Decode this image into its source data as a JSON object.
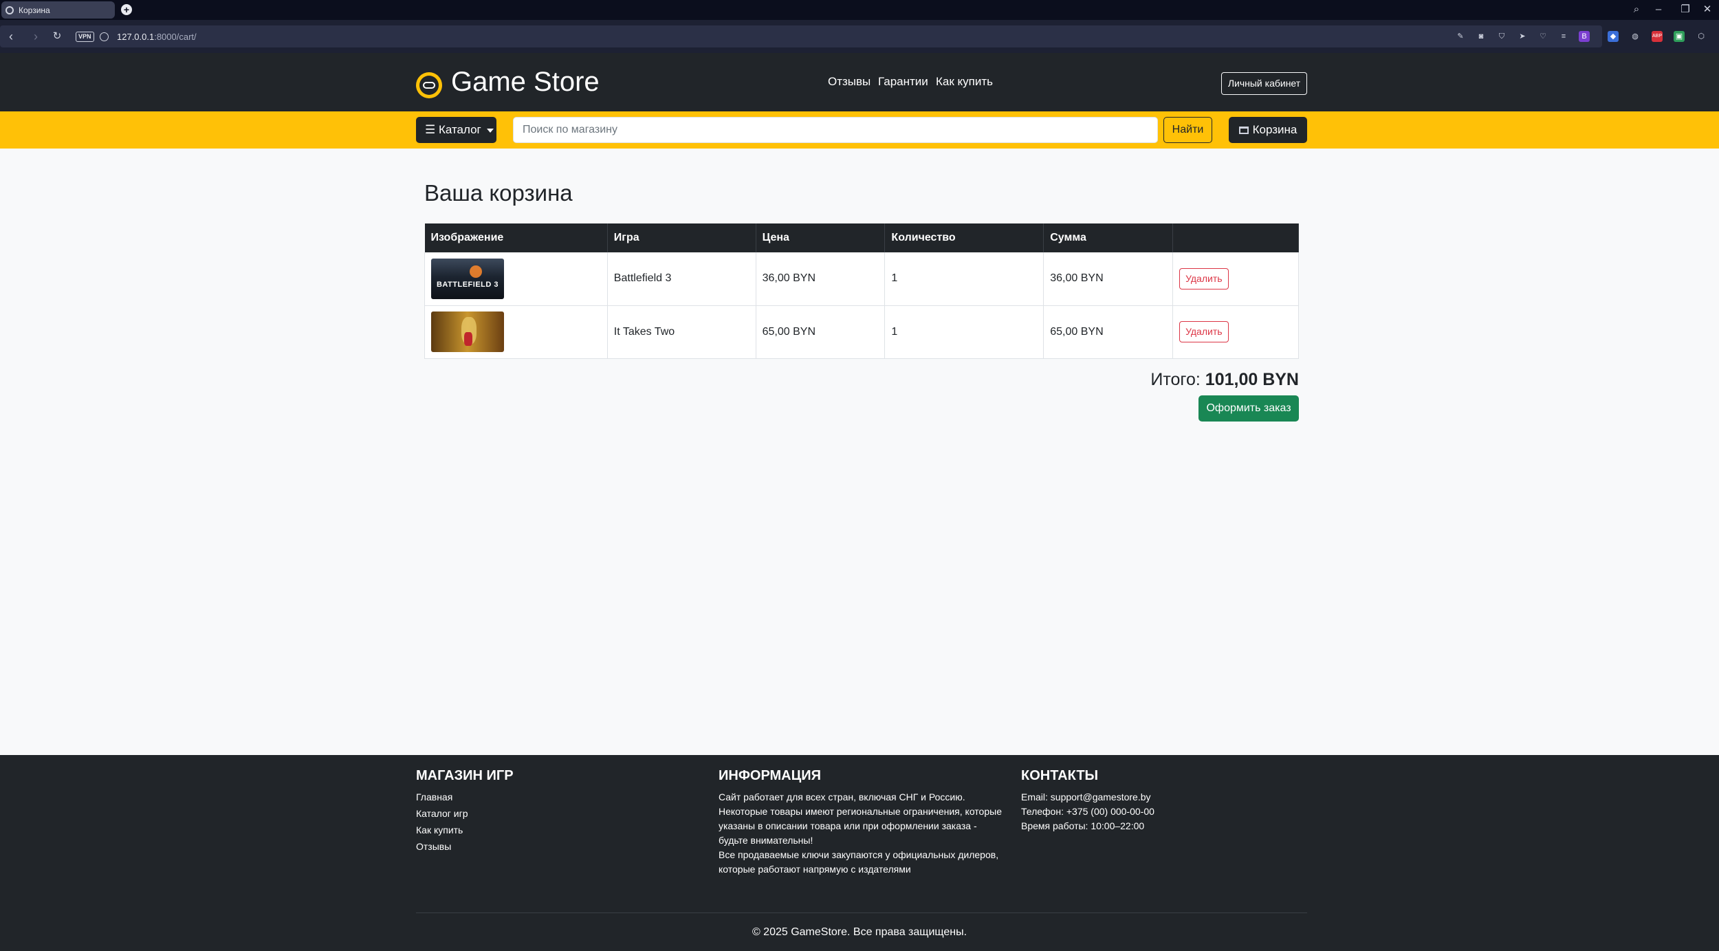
{
  "browser": {
    "tab_title": "Корзина",
    "url_host": "127.0.0.1",
    "url_rest": ":8000/cart/",
    "vpn_label": "VPN",
    "extension_icons": [
      "edit-icon",
      "camera-icon",
      "shield-icon",
      "send-icon",
      "heart-icon",
      "menu-icon",
      "profile-icon",
      "puzzle-icon",
      "globe-icon",
      "adblock-icon",
      "ext-icon",
      "box-icon"
    ]
  },
  "header": {
    "brand": "Game Store",
    "nav": [
      "Отзывы",
      "Гарантии",
      "Как купить"
    ],
    "cabinet_label": "Личный кабинет"
  },
  "searchbar": {
    "catalog_label": "☰ Каталог",
    "placeholder": "Поиск по магазину",
    "find_label": "Найти",
    "cart_label": "Корзина"
  },
  "cart": {
    "title": "Ваша корзина",
    "columns": [
      "Изображение",
      "Игра",
      "Цена",
      "Количество",
      "Сумма",
      ""
    ],
    "rows": [
      {
        "game": "Battlefield 3",
        "price": "36,00 BYN",
        "qty": "1",
        "sum": "36,00 BYN",
        "delete_label": "Удалить",
        "thumb_text": "BATTLEFIELD 3"
      },
      {
        "game": "It Takes Two",
        "price": "65,00 BYN",
        "qty": "1",
        "sum": "65,00 BYN",
        "delete_label": "Удалить"
      }
    ],
    "total_label": "Итого:",
    "total_value": "101,00 BYN",
    "checkout_label": "Оформить заказ"
  },
  "footer": {
    "col1": {
      "heading": "МАГАЗИН ИГР",
      "links": [
        "Главная",
        "Каталог игр",
        "Как купить",
        "Отзывы"
      ]
    },
    "col2": {
      "heading": "ИНФОРМАЦИЯ",
      "lines": [
        "Сайт работает для всех стран, включая СНГ и Россию.",
        "Некоторые товары имеют региональные ограничения, которые",
        "указаны в описании товара или при оформлении заказа -",
        "будьте внимательны!",
        "Все продаваемые ключи закупаются у официальных дилеров,",
        "которые работают напрямую с издателями"
      ]
    },
    "col3": {
      "heading": "КОНТАКТЫ",
      "lines": [
        "Email: support@gamestore.by",
        "Телефон: +375 (00) 000-00-00",
        "Время работы: 10:00–22:00"
      ]
    },
    "copyright": "© 2025 GameStore. Все права защищены."
  },
  "colors": {
    "accent": "#ffc107",
    "dark": "#212529",
    "success": "#198754",
    "danger": "#dc3545",
    "page_bg": "#f8f9fa"
  }
}
